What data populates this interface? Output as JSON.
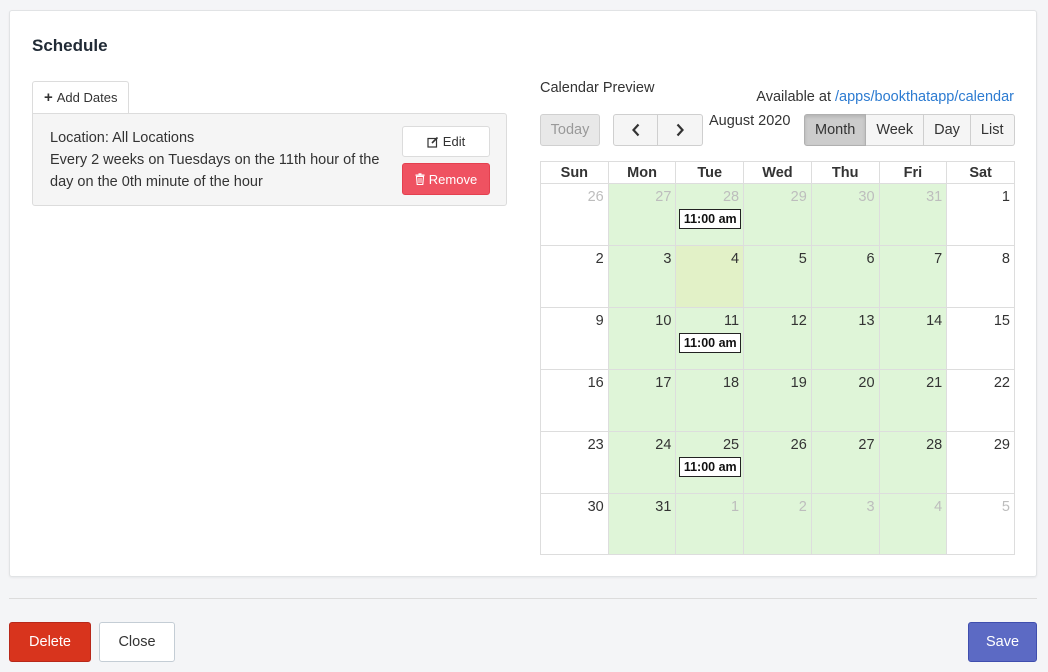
{
  "card": {
    "title": "Schedule"
  },
  "schedule": {
    "add_dates_label": "Add Dates",
    "rule_line1": "Location: All Locations",
    "rule_line2": "Every 2 weeks on Tuesdays on the 11th hour of the day on the 0th minute of the hour",
    "edit_label": "Edit",
    "remove_label": "Remove"
  },
  "calendar": {
    "preview_label": "Calendar Preview",
    "available_prefix": "Available at ",
    "available_link": "/apps/bookthatapp/calendar",
    "today_label": "Today",
    "title": "August 2020",
    "views": [
      {
        "label": "Month",
        "active": true
      },
      {
        "label": "Week",
        "active": false
      },
      {
        "label": "Day",
        "active": false
      },
      {
        "label": "List",
        "active": false
      }
    ],
    "weekdays": [
      "Sun",
      "Mon",
      "Tue",
      "Wed",
      "Thu",
      "Fri",
      "Sat"
    ],
    "weeks": [
      [
        {
          "d": "26",
          "o": 1,
          "a": 0
        },
        {
          "d": "27",
          "o": 1,
          "a": 1
        },
        {
          "d": "28",
          "o": 1,
          "a": 1,
          "e": "11:00 am"
        },
        {
          "d": "29",
          "o": 1,
          "a": 1
        },
        {
          "d": "30",
          "o": 1,
          "a": 1
        },
        {
          "d": "31",
          "o": 1,
          "a": 1
        },
        {
          "d": "1",
          "o": 0,
          "a": 0
        }
      ],
      [
        {
          "d": "2",
          "o": 0,
          "a": 0
        },
        {
          "d": "3",
          "o": 0,
          "a": 1
        },
        {
          "d": "4",
          "o": 0,
          "a": 1,
          "t": 1
        },
        {
          "d": "5",
          "o": 0,
          "a": 1
        },
        {
          "d": "6",
          "o": 0,
          "a": 1
        },
        {
          "d": "7",
          "o": 0,
          "a": 1
        },
        {
          "d": "8",
          "o": 0,
          "a": 0
        }
      ],
      [
        {
          "d": "9",
          "o": 0,
          "a": 0
        },
        {
          "d": "10",
          "o": 0,
          "a": 1
        },
        {
          "d": "11",
          "o": 0,
          "a": 1,
          "e": "11:00 am"
        },
        {
          "d": "12",
          "o": 0,
          "a": 1
        },
        {
          "d": "13",
          "o": 0,
          "a": 1
        },
        {
          "d": "14",
          "o": 0,
          "a": 1
        },
        {
          "d": "15",
          "o": 0,
          "a": 0
        }
      ],
      [
        {
          "d": "16",
          "o": 0,
          "a": 0
        },
        {
          "d": "17",
          "o": 0,
          "a": 1
        },
        {
          "d": "18",
          "o": 0,
          "a": 1
        },
        {
          "d": "19",
          "o": 0,
          "a": 1
        },
        {
          "d": "20",
          "o": 0,
          "a": 1
        },
        {
          "d": "21",
          "o": 0,
          "a": 1
        },
        {
          "d": "22",
          "o": 0,
          "a": 0
        }
      ],
      [
        {
          "d": "23",
          "o": 0,
          "a": 0
        },
        {
          "d": "24",
          "o": 0,
          "a": 1
        },
        {
          "d": "25",
          "o": 0,
          "a": 1,
          "e": "11:00 am"
        },
        {
          "d": "26",
          "o": 0,
          "a": 1
        },
        {
          "d": "27",
          "o": 0,
          "a": 1
        },
        {
          "d": "28",
          "o": 0,
          "a": 1
        },
        {
          "d": "29",
          "o": 0,
          "a": 0
        }
      ],
      [
        {
          "d": "30",
          "o": 0,
          "a": 0
        },
        {
          "d": "31",
          "o": 0,
          "a": 1
        },
        {
          "d": "1",
          "o": 1,
          "a": 1
        },
        {
          "d": "2",
          "o": 1,
          "a": 1
        },
        {
          "d": "3",
          "o": 1,
          "a": 1
        },
        {
          "d": "4",
          "o": 1,
          "a": 1
        },
        {
          "d": "5",
          "o": 1,
          "a": 0
        }
      ]
    ],
    "colors": {
      "available": "#dff5d8",
      "today": "#e2f1c7",
      "link": "#2c7bd1"
    }
  },
  "footer": {
    "delete_label": "Delete",
    "close_label": "Close",
    "save_label": "Save",
    "colors": {
      "delete": "#d8341d",
      "save": "#5c6ac4"
    }
  }
}
